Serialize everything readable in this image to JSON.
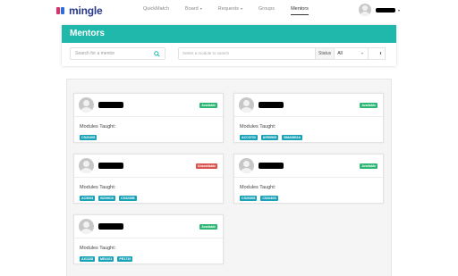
{
  "app": {
    "logo_text": "mingle"
  },
  "nav": {
    "links": [
      {
        "label": "QuickMatch",
        "caret": false
      },
      {
        "label": "Board",
        "caret": true
      },
      {
        "label": "Requests",
        "caret": true
      },
      {
        "label": "Groups",
        "caret": false
      },
      {
        "label": "Mentors",
        "caret": false,
        "active": true
      }
    ]
  },
  "user": {
    "caret": "▾"
  },
  "header": {
    "title": "Mentors"
  },
  "filters": {
    "search_placeholder": "Search for a mentor",
    "module_placeholder": "Select a module to search",
    "status_label": "Status",
    "status_value": "All"
  },
  "mentors": [
    {
      "status": "Available",
      "status_type": "ok",
      "modules_label": "Modules Taught:",
      "modules": [
        "CS2040S"
      ]
    },
    {
      "status": "Available",
      "status_type": "ok",
      "modules_label": "Modules Taught:",
      "modules": [
        "ACC3703",
        "AR5956S",
        "BMA5802A"
      ]
    },
    {
      "status": "Unavailable",
      "status_type": "bad",
      "modules_label": "Modules Taught:",
      "modules": [
        "AC5003",
        "BZ09010",
        "CS3230B"
      ]
    },
    {
      "status": "Available",
      "status_type": "ok",
      "modules_label": "Modules Taught:",
      "modules": [
        "CS2030S",
        "CS2040S"
      ]
    },
    {
      "status": "Available",
      "status_type": "ok",
      "modules_label": "Modules Taught:",
      "modules": [
        "AX1228",
        "ME4101",
        "PR1710"
      ]
    }
  ],
  "colors": {
    "accent": "#1fb8ab",
    "module_tag": "#17a2b8",
    "available": "#2bb673",
    "unavailable": "#d9534f"
  }
}
